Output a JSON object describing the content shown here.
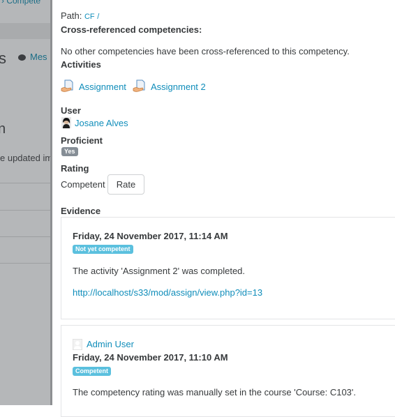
{
  "background_page": {
    "breadcrumb": "› Compete",
    "heading_fragment": "s",
    "messages_link": "Mes",
    "heading2_fragment": "n",
    "text_fragment": "e updated im"
  },
  "path": {
    "label": "Path:",
    "link": "CF",
    "separator": "/"
  },
  "cross_referenced": {
    "heading": "Cross-referenced competencies:",
    "text": "No other competencies have been cross-referenced to this competency."
  },
  "activities": {
    "heading": "Activities",
    "items": [
      {
        "label": "Assignment",
        "icon": "assignment-icon"
      },
      {
        "label": "Assignment 2",
        "icon": "assignment-icon"
      }
    ]
  },
  "user": {
    "heading": "User",
    "name": "Josane Alves"
  },
  "proficient": {
    "heading": "Proficient",
    "badge": "Yes"
  },
  "rating": {
    "heading": "Rating",
    "value": "Competent",
    "rate_button": "Rate"
  },
  "evidence": {
    "heading": "Evidence",
    "items": [
      {
        "date": "Friday, 24 November 2017, 11:14 AM",
        "badge": "Not yet competent",
        "description": "The activity 'Assignment 2' was completed.",
        "url": "http://localhost/s33/mod/assign/view.php?id=13"
      },
      {
        "author": "Admin User",
        "date": "Friday, 24 November 2017, 11:10 AM",
        "badge": "Competent",
        "description": "The competency rating was manually set in the course 'Course: C103'."
      }
    ]
  },
  "colors": {
    "link": "#0f8dba",
    "badge_secondary": "#868e96",
    "badge_info": "#5bc0de",
    "overlay": "#b5b7b9"
  }
}
